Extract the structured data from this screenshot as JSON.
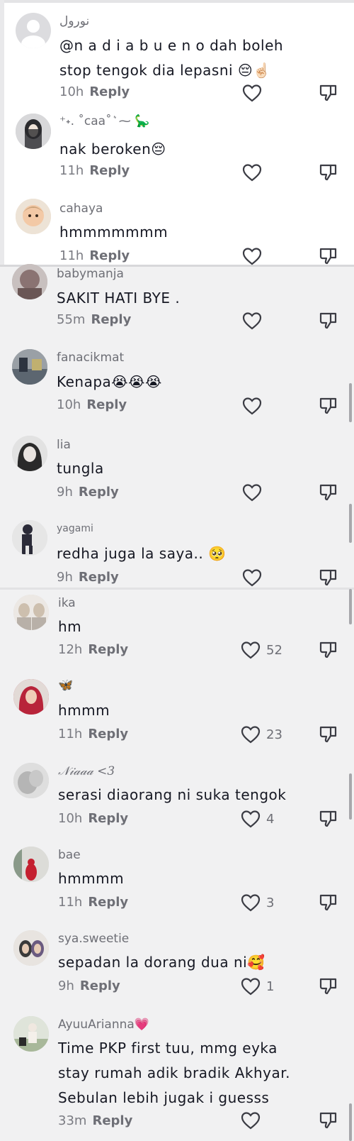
{
  "comments": [
    {
      "username": "نورول",
      "text": "@n a d i a b u e n o dah boleh\nstop tengok dia lepasni 😔☝🏻",
      "time": "10h",
      "reply": "Reply",
      "likes": ""
    },
    {
      "username": "⁺˖. ˚caa˚ ͛ ⁓ 🦕",
      "text": "nak beroken😔",
      "time": "11h",
      "reply": "Reply",
      "likes": ""
    },
    {
      "username": "cahaya",
      "text": "hmmmmmmm",
      "time": "11h",
      "reply": "Reply",
      "likes": ""
    },
    {
      "username": "babymanja",
      "text": "SAKIT HATI BYE .",
      "time": "55m",
      "reply": "Reply",
      "likes": ""
    },
    {
      "username": "fanacikmat",
      "text": "Kenapa😭😭😭",
      "time": "10h",
      "reply": "Reply",
      "likes": ""
    },
    {
      "username": "lia",
      "text": "tungla",
      "time": "9h",
      "reply": "Reply",
      "likes": ""
    },
    {
      "username": "yagami",
      "text": "redha juga la saya.. 🥺",
      "time": "9h",
      "reply": "Reply",
      "likes": ""
    },
    {
      "username": "ika",
      "text": "hm",
      "time": "12h",
      "reply": "Reply",
      "likes": "52"
    },
    {
      "username": "🦋",
      "text": "hmmm",
      "time": "11h",
      "reply": "Reply",
      "likes": "23"
    },
    {
      "username": "𝒩𝒾𝒶𝒶𝒶 <3",
      "text": "serasi diaorang ni suka tengok",
      "time": "10h",
      "reply": "Reply",
      "likes": "4"
    },
    {
      "username": "bae",
      "text": "hmmmm",
      "time": "11h",
      "reply": "Reply",
      "likes": "3"
    },
    {
      "username": "sya.sweetie",
      "text": "sepadan la dorang dua ni🥰",
      "time": "9h",
      "reply": "Reply",
      "likes": "1"
    },
    {
      "username": "AyuuArianna💗",
      "text": "Time PKP first tuu, mmg eyka\nstay rumah adik bradik Akhyar.\nSebulan lebih jugak i guesss",
      "time": "33m",
      "reply": "Reply",
      "likes": ""
    }
  ],
  "icons": {
    "like": "heart-outline-icon",
    "dislike": "thumbs-down-icon",
    "avatar": "user-avatar"
  },
  "colors": {
    "text": "#161823",
    "meta": "#7a7b82",
    "background": "#f1f1f2"
  }
}
